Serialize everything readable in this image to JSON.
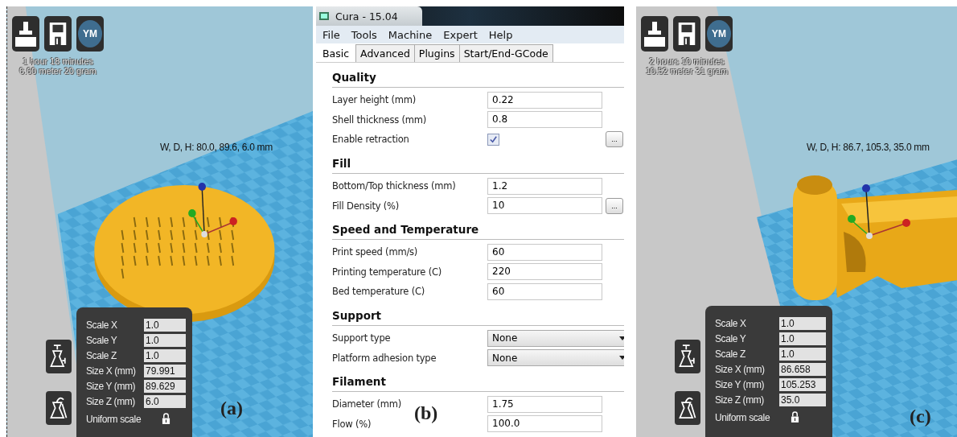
{
  "panels": [
    {
      "kind": "viewport",
      "avatar": "YM",
      "print_time": "1 hour 18 minutes",
      "material": "6.60 meter 20 gram",
      "dimensions": "W, D, H: 80.0, 89.6, 6.0 mm",
      "scale_rows": [
        {
          "label": "Scale X",
          "value": "1.0"
        },
        {
          "label": "Scale Y",
          "value": "1.0"
        },
        {
          "label": "Scale Z",
          "value": "1.0"
        },
        {
          "label": "Size X (mm)",
          "value": "79.991"
        },
        {
          "label": "Size Y (mm)",
          "value": "89.629"
        },
        {
          "label": "Size Z (mm)",
          "value": "6.0"
        }
      ],
      "uniform_scale": "Uniform scale",
      "caption": "(a)"
    },
    {
      "kind": "settings",
      "title": "Cura - 15.04",
      "menu": [
        "File",
        "Tools",
        "Machine",
        "Expert",
        "Help"
      ],
      "tabs": [
        {
          "label": "Basic",
          "selected": true
        },
        {
          "label": "Advanced",
          "selected": false
        },
        {
          "label": "Plugins",
          "selected": false
        },
        {
          "label": "Start/End-GCode",
          "selected": false
        }
      ],
      "sections": [
        {
          "title": "Quality",
          "rows": [
            {
              "kind": "text",
              "label": "Layer height (mm)",
              "value": "0.22"
            },
            {
              "kind": "text",
              "label": "Shell thickness (mm)",
              "value": "0.8"
            },
            {
              "kind": "checkbox",
              "label": "Enable retraction",
              "checked": true,
              "button": "..."
            }
          ]
        },
        {
          "title": "Fill",
          "rows": [
            {
              "kind": "text",
              "label": "Bottom/Top thickness (mm)",
              "value": "1.2"
            },
            {
              "kind": "text",
              "label": "Fill Density (%)",
              "value": "10",
              "button": "..."
            }
          ]
        },
        {
          "title": "Speed and Temperature",
          "rows": [
            {
              "kind": "text",
              "label": "Print speed (mm/s)",
              "value": "60"
            },
            {
              "kind": "text",
              "label": "Printing temperature (C)",
              "value": "220"
            },
            {
              "kind": "text",
              "label": "Bed temperature (C)",
              "value": "60"
            }
          ]
        },
        {
          "title": "Support",
          "rows": [
            {
              "kind": "select",
              "label": "Support type",
              "value": "None"
            },
            {
              "kind": "select",
              "label": "Platform adhesion type",
              "value": "None"
            }
          ]
        },
        {
          "title": "Filament",
          "rows": [
            {
              "kind": "text",
              "label": "Diameter (mm)",
              "value": "1.75"
            },
            {
              "kind": "text",
              "label": "Flow (%)",
              "value": "100.0"
            }
          ]
        }
      ],
      "caption": "(b)"
    },
    {
      "kind": "viewport",
      "avatar": "YM",
      "print_time": "2 hours 10 minutes",
      "material": "10.52 meter 31 gram",
      "dimensions": "W, D, H: 86.7, 105.3, 35.0 mm",
      "scale_rows": [
        {
          "label": "Scale X",
          "value": "1.0"
        },
        {
          "label": "Scale Y",
          "value": "1.0"
        },
        {
          "label": "Scale Z",
          "value": "1.0"
        },
        {
          "label": "Size X (mm)",
          "value": "86.658"
        },
        {
          "label": "Size Y (mm)",
          "value": "105.253"
        },
        {
          "label": "Size Z (mm)",
          "value": "35.0"
        }
      ],
      "uniform_scale": "Uniform scale",
      "caption": "(c)"
    }
  ]
}
